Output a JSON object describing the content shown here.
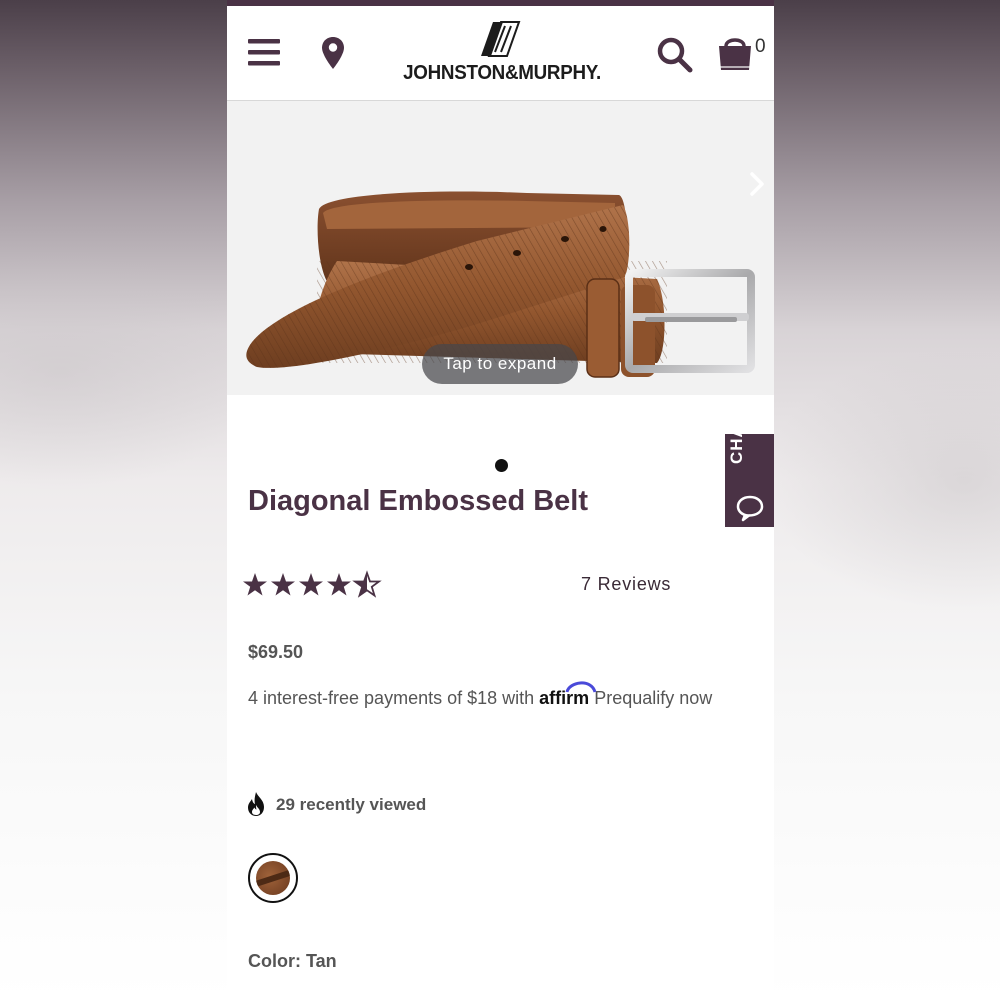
{
  "brand": {
    "name": "JOHNSTON & MURPHY",
    "logo_text": "JOHNSTON&MURPHY.",
    "color": "#4a3245"
  },
  "header": {
    "menu_icon": "hamburger-menu-icon",
    "location_icon": "map-pin-icon",
    "search_icon": "search-icon",
    "cart_icon": "shopping-bag-icon",
    "cart_count": "0"
  },
  "gallery": {
    "expand_label": "Tap to expand",
    "next_icon": "chevron-right-icon",
    "image_subject": "Tan leather belt with diagonal embossed texture and silver buckle",
    "active_dot": 1,
    "total_dots": 1
  },
  "chat": {
    "label": "CHAT",
    "icon": "chat-bubble-icon"
  },
  "product": {
    "title": "Diagonal Embossed Belt",
    "rating": 4.5,
    "rating_max": 5,
    "reviews_label": "7 Reviews",
    "price": "$69.50",
    "financing": {
      "prefix": "4 interest-free payments of $18 with",
      "provider": "affirm",
      "link": "Prequalify now"
    },
    "recently_viewed": "29 recently viewed",
    "recently_viewed_icon": "flame-icon",
    "color_label": "Color: Tan",
    "selected_swatch": "Tan"
  }
}
